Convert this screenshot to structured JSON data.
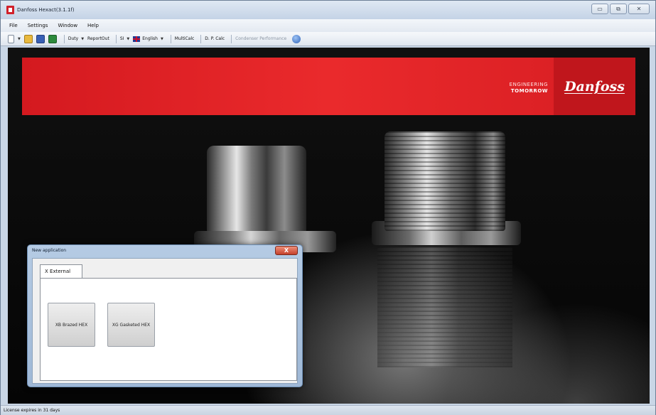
{
  "window": {
    "title": "Danfoss Hexact(3.1.1f)",
    "controls": {
      "minimize": "▭",
      "maximize": "⧉",
      "close": "✕"
    }
  },
  "menu": [
    "File",
    "Settings",
    "Window",
    "Help"
  ],
  "toolbar": {
    "icons": [
      "new-file-icon",
      "open-folder-icon",
      "save-icon",
      "excel-export-icon"
    ],
    "duty_label": "Duty",
    "reportout_label": "ReportOut",
    "units_label": "SI",
    "language_label": "English",
    "multicalc_label": "MultiCalc",
    "dpcalc_label": "D. P. Calc",
    "condenser_label": "Condenser Performance",
    "dropdown_glyph": "▼"
  },
  "banner": {
    "tagline_line1": "ENGINEERING",
    "tagline_line2": "TOMORROW",
    "logo": "Danfoss",
    "color": "#e32229"
  },
  "dialog": {
    "title": "New application",
    "close_glyph": "X",
    "tab_label": "X External",
    "buttons": [
      {
        "label": "XB Brazed HEX"
      },
      {
        "label": "XG Gasketed HEX"
      }
    ]
  },
  "status": {
    "text": "License expires in 31 days"
  }
}
